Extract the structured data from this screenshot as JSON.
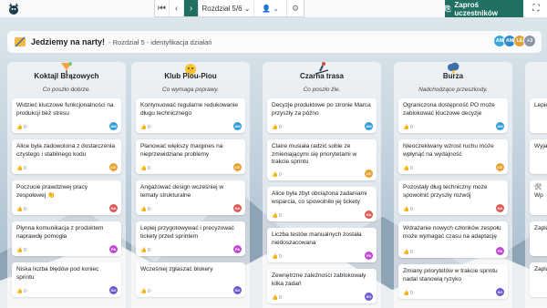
{
  "nav": {
    "stage": "Rozdział 5/6",
    "invite_label": "Zaproś uczestników"
  },
  "header": {
    "title": "Jedziemy na narty!",
    "subtitle": "- Rozdział 5 - identyfikacja działań",
    "avatars": [
      {
        "initials": "AM",
        "color": "#3aa7d8"
      },
      {
        "initials": "AM",
        "color": "#2f86c8"
      },
      {
        "initials": "LE",
        "color": "#e1a23a"
      },
      {
        "initials": "+3",
        "color": "#8a96a3"
      }
    ]
  },
  "columns": [
    {
      "title": "Koktajl Brązowych",
      "hint": "Co poszło dobrze.",
      "cards": [
        {
          "text": "Widzieć kluczowe funkcjonalności na produkcji bez stresu",
          "votes": "0",
          "author": "AM",
          "color": "#2f9fd8"
        },
        {
          "text": "Alice była zadowolona z dostarczenia czystego i stabilnego kodu",
          "votes": "0",
          "author": "LE",
          "color": "#e6a532"
        },
        {
          "text": "Poczucie prawdziwej pracy zespołowej 👏",
          "votes": "0",
          "author": "NA",
          "color": "#e05a5a"
        },
        {
          "text": "Płynna komunikacja z produktem naprawdę pomogła",
          "votes": "0",
          "author": "PA",
          "color": "#c04bd0"
        },
        {
          "text": "Niska liczba błędów pod koniec sprintu",
          "votes": "0",
          "author": "SO",
          "color": "#6a5acd"
        }
      ]
    },
    {
      "title": "Klub Piou-Piou",
      "hint": "Co wymaga poprawy.",
      "cards": [
        {
          "text": "Kontynuować regularne redukowanie długu technicznego",
          "votes": "0",
          "author": "AM",
          "color": "#2f9fd8"
        },
        {
          "text": "Planować większy margines na nieprzewidziane problemy",
          "votes": "0",
          "author": "LE",
          "color": "#e6a532"
        },
        {
          "text": "Angażować design wcześniej w tematy strukturalne",
          "votes": "0",
          "author": "NA",
          "color": "#e05a5a"
        },
        {
          "text": "Lepiej przygotowywać i precyzować tickety przed sprintem",
          "votes": "0",
          "author": "PA",
          "color": "#c04bd0"
        },
        {
          "text": "Wcześniej zgłaszać blokery",
          "votes": "0",
          "author": "SO",
          "color": "#6a5acd"
        }
      ]
    },
    {
      "title": "Czarna trasa",
      "hint": "Co poszło źle.",
      "cards": [
        {
          "text": "Decyzje produktowe po stronie Marca przyszły za późno",
          "votes": "0",
          "author": "AM",
          "color": "#2f9fd8"
        },
        {
          "text": "Claire musiała radzić sobie ze zmieniającymi się priorytetami w trakcie sprintu",
          "votes": "0",
          "author": "LE",
          "color": "#e6a532"
        },
        {
          "text": "Alice była zbyt obciążona zadaniami wsparcia, co spowolniło jej tickety",
          "votes": "0",
          "author": "NA",
          "color": "#e05a5a"
        },
        {
          "text": "Liczba testów manualnych została niedoszacowana",
          "votes": "0",
          "author": "PA",
          "color": "#c04bd0"
        },
        {
          "text": "Zewnętrzne zależności zablokowały kilka zadań",
          "votes": "0",
          "author": "SO",
          "color": "#6a5acd"
        }
      ]
    },
    {
      "title": "Burza",
      "hint": "Nadchodzące przeszkody.",
      "cards": [
        {
          "text": "Ograniczona dostępność PO może zablokować kluczowe decyzje",
          "votes": "0",
          "author": "AM",
          "color": "#2f9fd8"
        },
        {
          "text": "Nieoczekiwany wzrost ruchu może wpłynąć na wydajność",
          "votes": "0",
          "author": "LE",
          "color": "#e6a532"
        },
        {
          "text": "Pozostały dług techniczny może spowolnić przyszły rozwój",
          "votes": "0",
          "author": "NA",
          "color": "#e05a5a"
        },
        {
          "text": "Wdrażanie nowych członków zespołu może wymagać czasu na adaptację",
          "votes": "0",
          "author": "PA",
          "color": "#c04bd0"
        },
        {
          "text": "Zmiany priorytetów w trakcie sprintu nadal stanowią ryzyko",
          "votes": "0",
          "author": "SO",
          "color": "#6a5acd"
        }
      ]
    },
    {
      "title": "",
      "hint": "",
      "cards": [
        {
          "text": "Lepiej",
          "votes": "0",
          "author": "",
          "color": "#2f9fd8"
        },
        {
          "text": "Wyja",
          "votes": "0",
          "author": "",
          "color": "#e6a532"
        },
        {
          "text": "🛠 Wp",
          "votes": "0",
          "author": "",
          "color": "#e05a5a"
        },
        {
          "text": "Zaplan",
          "votes": "0",
          "author": "",
          "color": "#c04bd0"
        },
        {
          "text": "Zaplan",
          "votes": "0",
          "author": "",
          "color": "#6a5acd"
        }
      ]
    }
  ]
}
